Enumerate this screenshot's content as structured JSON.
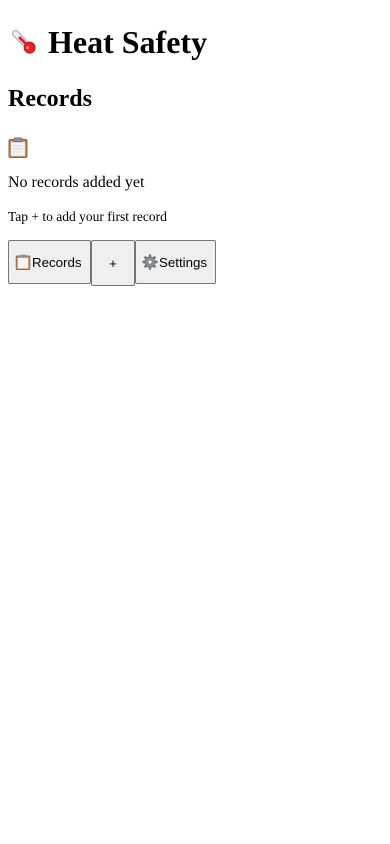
{
  "header": {
    "title": "Heat Safety",
    "title_icon": "thermometer-icon"
  },
  "main": {
    "section_title": "Records",
    "empty_state": {
      "icon": "clipboard-icon",
      "title": "No records added yet",
      "hint": "Tap + to add your first record"
    }
  },
  "nav": {
    "records_label": "Records",
    "records_icon": "clipboard-icon",
    "add_label": "+",
    "settings_label": "Settings",
    "settings_icon": "gear-icon"
  },
  "colors": {
    "thermometer_bulb": "#e0262b",
    "clipboard_board": "#b5895a",
    "button_bg": "#efefef",
    "button_border": "#767676"
  }
}
